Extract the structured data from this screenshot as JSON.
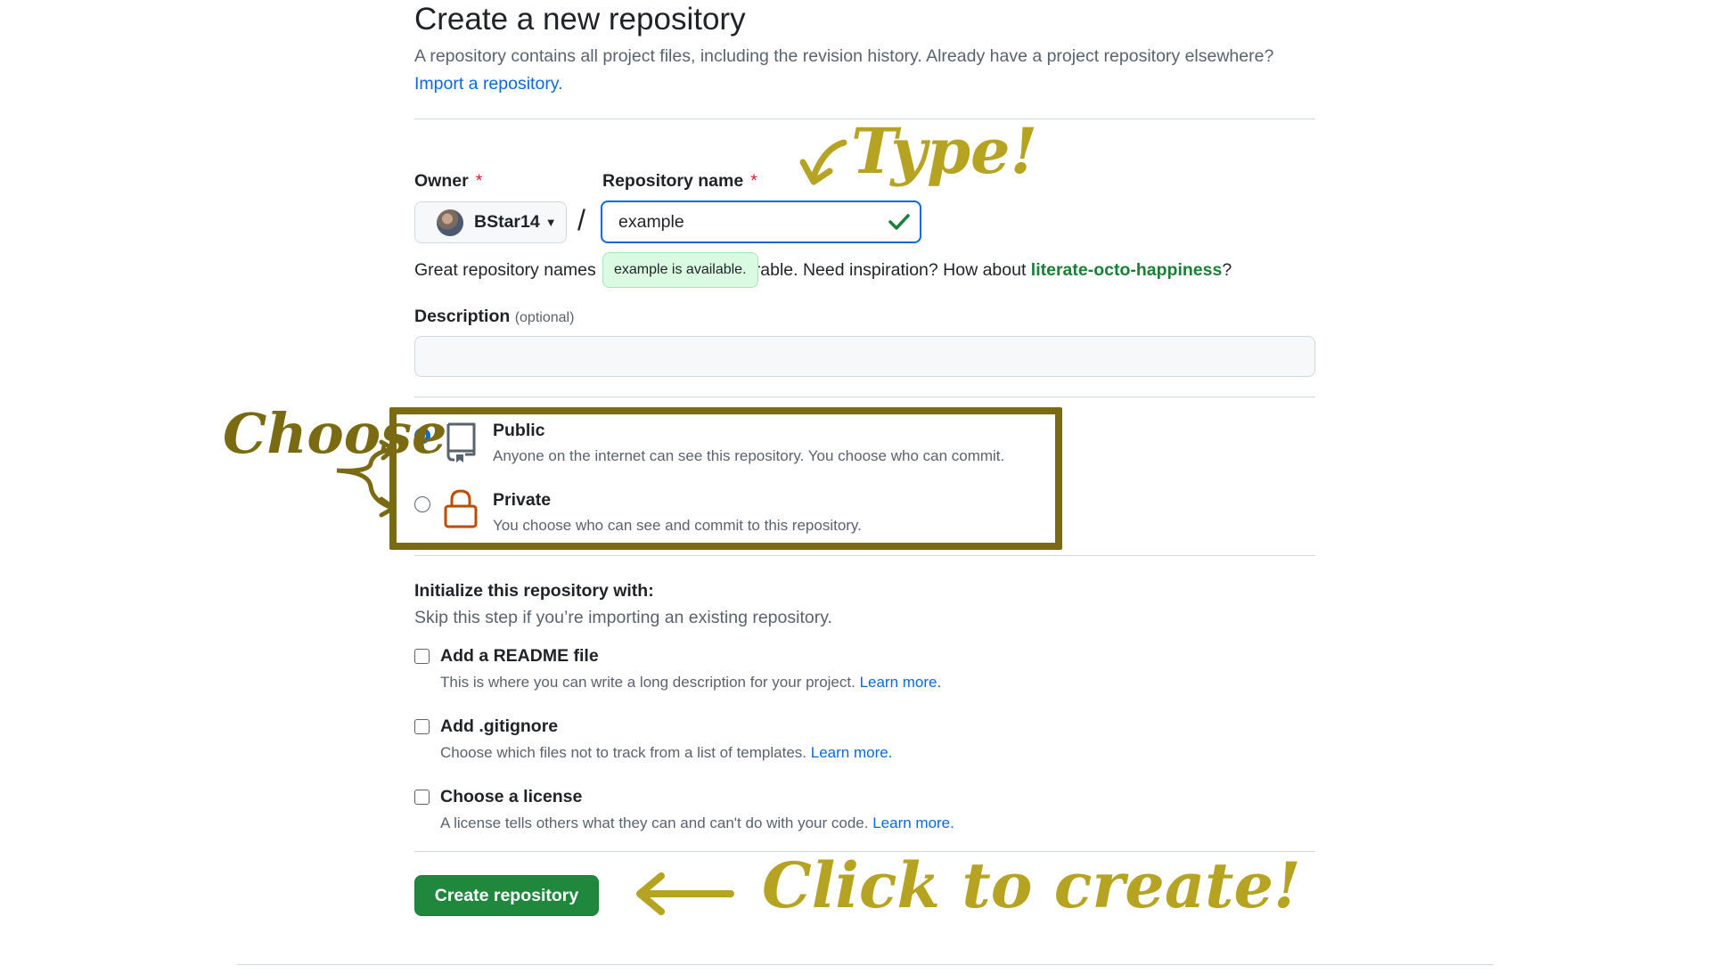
{
  "header": {
    "title": "Create a new repository",
    "subtitle": "A repository contains all project files, including the revision history. Already have a project repository elsewhere?",
    "import_link": "Import a repository."
  },
  "owner": {
    "label": "Owner",
    "required": "*",
    "value": "BStar14",
    "icon": "caret-down-icon"
  },
  "slash": "/",
  "repo_name": {
    "label": "Repository name",
    "required": "*",
    "value": "example",
    "status_icon": "check-icon",
    "tooltip": "example is available."
  },
  "suggestion": {
    "prefix": "Great repository names",
    "middle": "rable. Need inspiration? How about ",
    "link": "literate-octo-happiness",
    "suffix": "?"
  },
  "description": {
    "label": "Description",
    "optional": "(optional)",
    "value": ""
  },
  "visibility": {
    "selected": "public",
    "options": [
      {
        "id": "public",
        "title": "Public",
        "desc": "Anyone on the internet can see this repository. You choose who can commit.",
        "icon": "repo-icon"
      },
      {
        "id": "private",
        "title": "Private",
        "desc": "You choose who can see and commit to this repository.",
        "icon": "lock-icon"
      }
    ]
  },
  "initialize": {
    "title": "Initialize this repository with:",
    "subtitle": "Skip this step if you’re importing an existing repository.",
    "items": [
      {
        "label": "Add a README file",
        "desc": "This is where you can write a long description for your project.",
        "link": "Learn more.",
        "checked": false
      },
      {
        "label": "Add .gitignore",
        "desc": "Choose which files not to track from a list of templates.",
        "link": "Learn more.",
        "checked": false
      },
      {
        "label": "Choose a license",
        "desc": "A license tells others what they can and can't do with your code.",
        "link": "Learn more.",
        "checked": false
      }
    ]
  },
  "submit": {
    "label": "Create repository"
  },
  "annotations": {
    "type": "Type!",
    "choose": "Choose",
    "click": "Click to create!",
    "color": "#b5a321",
    "box_color": "#7a6b12"
  },
  "colors": {
    "accent": "#0969da",
    "success": "#1f883d",
    "required": "#cf222e"
  }
}
